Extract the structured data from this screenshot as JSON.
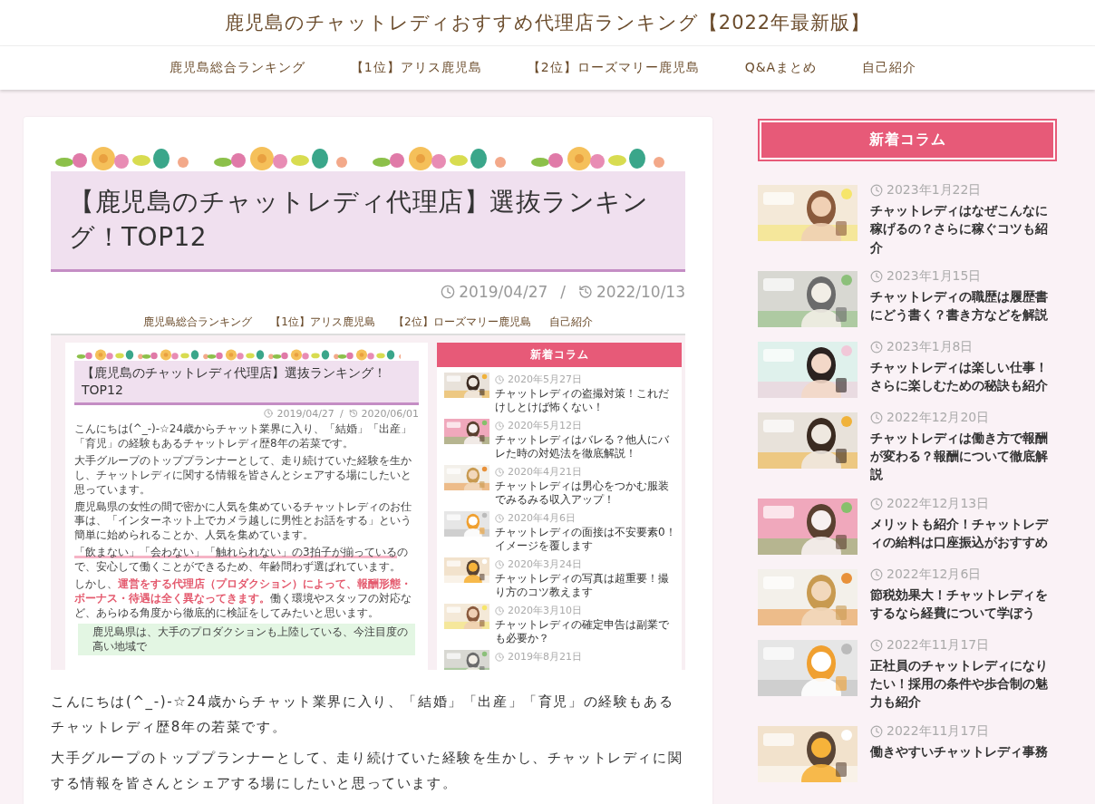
{
  "site_title": "鹿児島のチャットレディおすすめ代理店ランキング【2022年最新版】",
  "nav": [
    "鹿児島総合ランキング",
    "【1位】アリス鹿児島",
    "【2位】ローズマリー鹿児島",
    "Q&Aまとめ",
    "自己紹介"
  ],
  "article": {
    "title": "【鹿児島のチャットレディ代理店】選抜ランキング！TOP12",
    "published": "2019/04/27",
    "separator": "/",
    "updated": "2022/10/13",
    "screenshot": {
      "nav": [
        "鹿児島総合ランキング",
        "【1位】アリス鹿児島",
        "【2位】ローズマリー鹿児島",
        "自己紹介"
      ],
      "title": "【鹿児島のチャットレディ代理店】選抜ランキング！TOP12",
      "published": "2019/04/27",
      "separator": "/",
      "updated": "2020/06/01",
      "paragraphs": [
        [
          {
            "kind": "plain",
            "text": "こんにちは(^_-)-☆24歳からチャット業界に入り、「結婚」「出産」「育児」の経験もあるチャットレディ歴8年の若菜です。"
          }
        ],
        [
          {
            "kind": "plain",
            "text": "大手グループのトッププランナーとして、走り続けていた経験を生かし、チャットレディに関する情報を皆さんとシェアする場にしたいと思っています。"
          }
        ],
        [
          {
            "kind": "plain",
            "text": "鹿児島県の女性の間で密かに人気を集めているチャットレディのお仕事は、「インターネット上でカメラ越しに男性とお話をする」という簡単に始められることか、人気を集めています。"
          }
        ],
        [
          {
            "kind": "marker",
            "text": "「飲まない」「会わない」「触れられない」の3拍子が揃っている"
          },
          {
            "kind": "plain",
            "text": "ので、安心して働くことができるため、年齢問わず選ばれています。"
          }
        ],
        [
          {
            "kind": "plain",
            "text": "しかし、"
          },
          {
            "kind": "emphasis",
            "text": "運営をする代理店（プロダクション）によって、報酬形態・ボーナス・待遇は全く異なってきます。"
          },
          {
            "kind": "plain",
            "text": "働く環境やスタッフの対応など、あらゆる角度から徹底的に検証をしてみたいと思います。"
          }
        ]
      ],
      "note": "鹿児島県は、大手のプロダクションも上陸している、今注目度の高い地域で",
      "sidebar": {
        "heading": "新着コラム",
        "posts": [
          {
            "date": "2020年5月27日",
            "title": "チャットレディの盗撮対策！これだけしとけば怖くない！"
          },
          {
            "date": "2020年5月12日",
            "title": "チャットレディはバレる？他人にバレた時の対処法を徹底解説！"
          },
          {
            "date": "2020年4月21日",
            "title": "チャットレディは男心をつかむ服装でみるみる収入アップ！"
          },
          {
            "date": "2020年4月6日",
            "title": "チャットレディの面接は不安要素0！イメージを覆します"
          },
          {
            "date": "2020年3月24日",
            "title": "チャットレディの写真は超重要！撮り方のコツ教えます"
          },
          {
            "date": "2020年3月10日",
            "title": "チャットレディの確定申告は副業でも必要か？"
          },
          {
            "date": "2019年8月21日"
          }
        ]
      }
    },
    "paragraphs": [
      "こんにちは(^_-)-☆24歳からチャット業界に入り、「結婚」「出産」「育児」の経験もあるチャットレディ歴8年の若菜です。",
      "大手グループのトッププランナーとして、走り続けていた経験を生かし、チャットレディに関する情報を皆さんとシェアする場にしたいと思っています。"
    ]
  },
  "sidebar": {
    "heading": "新着コラム",
    "posts": [
      {
        "date": "2023年1月22日",
        "title": "チャットレディはなぜこんなに稼げるの？さらに稼ぐコツも紹介"
      },
      {
        "date": "2023年1月15日",
        "title": "チャットレディの職歴は履歴書にどう書く？書き方などを解説"
      },
      {
        "date": "2023年1月8日",
        "title": "チャットレディは楽しい仕事！さらに楽しむための秘訣も紹介"
      },
      {
        "date": "2022年12月20日",
        "title": "チャットレディは働き方で報酬が変わる？報酬について徹底解説"
      },
      {
        "date": "2022年12月13日",
        "title": "メリットも紹介！チャットレディの給料は口座振込がおすすめ"
      },
      {
        "date": "2022年12月6日",
        "title": "節税効果大！チャットレディをするなら経費について学ぼう"
      },
      {
        "date": "2022年11月17日",
        "title": "正社員のチャットレディになりたい！採用の条件や歩合制の魅力も紹介"
      },
      {
        "date": "2022年11月17日",
        "title": "働きやすいチャットレディ事務"
      }
    ]
  }
}
